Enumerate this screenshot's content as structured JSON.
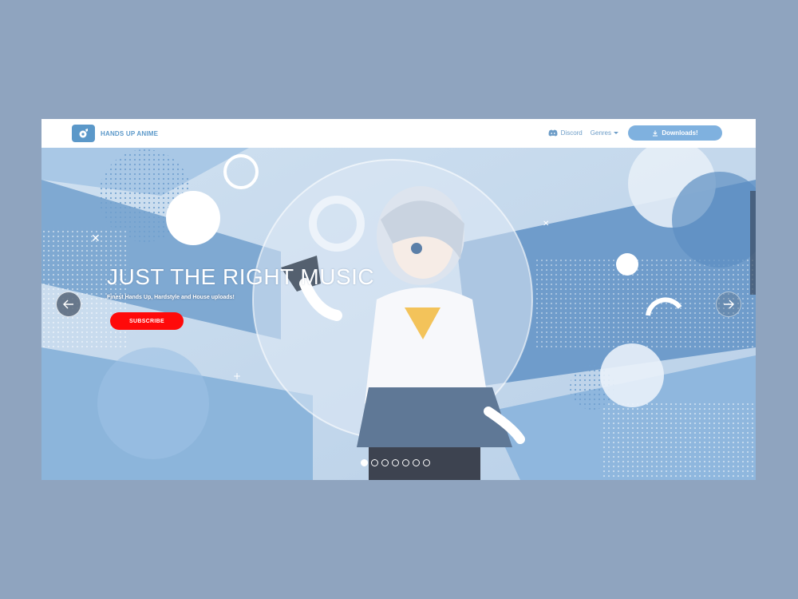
{
  "brand": {
    "name": "HANDS UP ANIME",
    "logo_icon": "music-note-icon"
  },
  "nav": {
    "discord_label": "Discord",
    "discord_icon": "discord-icon",
    "genres_label": "Genres",
    "downloads_label": "Downloads!",
    "downloads_icon": "download-icon"
  },
  "hero": {
    "title": "JUST THE RIGHT MUSIC",
    "subtitle": "Finest Hands Up, Hardstyle and House uploads!",
    "subscribe_label": "SUBSCRIBE",
    "slide_count": 7,
    "active_slide": 1
  },
  "colors": {
    "page_bg": "#8fa4bf",
    "brand": "#5b98c9",
    "download_button": "#7fb1df",
    "subscribe_button": "#ff0a0a"
  }
}
